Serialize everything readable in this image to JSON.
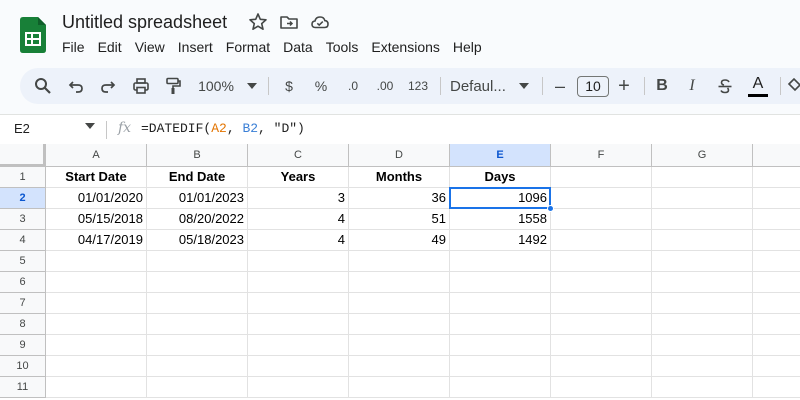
{
  "app": {
    "doc_title": "Untitled spreadsheet",
    "menu": [
      "File",
      "Edit",
      "View",
      "Insert",
      "Format",
      "Data",
      "Tools",
      "Extensions",
      "Help"
    ],
    "accent_color": "#1a73e8",
    "logo_color": "#188038"
  },
  "toolbar": {
    "zoom": "100%",
    "currency": "$",
    "percent": "%",
    "decrease_decimal": ".0",
    "increase_decimal": ".00",
    "number_format": "123",
    "font": "Defaul...",
    "font_size": "10",
    "minus": "–",
    "plus": "+",
    "bold": "B",
    "italic": "I",
    "text_color": "A",
    "icons": [
      "search-icon",
      "undo-icon",
      "redo-icon",
      "print-icon",
      "paint-format-icon",
      "bold-icon",
      "italic-icon",
      "strikethrough-icon",
      "text-color-icon",
      "fill-color-icon"
    ]
  },
  "formula_bar": {
    "name_box": "E2",
    "fx": "fx",
    "formula_prefix": "=DATEDIF(",
    "formula_ref1": "A2",
    "formula_sep": ", ",
    "formula_ref2": "B2",
    "formula_suffix": ", \"D\")"
  },
  "sheet": {
    "columns": [
      "A",
      "B",
      "C",
      "D",
      "E",
      "F",
      "G"
    ],
    "rows": [
      "1",
      "2",
      "3",
      "4",
      "5",
      "6",
      "7",
      "8",
      "9",
      "10",
      "11"
    ],
    "selected_cell": "E2",
    "headers": [
      "Start Date",
      "End Date",
      "Years",
      "Months",
      "Days"
    ],
    "data": [
      [
        "01/01/2020",
        "01/01/2023",
        "3",
        "36",
        "1096"
      ],
      [
        "05/15/2018",
        "08/20/2022",
        "4",
        "51",
        "1558"
      ],
      [
        "04/17/2019",
        "05/18/2023",
        "4",
        "49",
        "1492"
      ]
    ]
  }
}
